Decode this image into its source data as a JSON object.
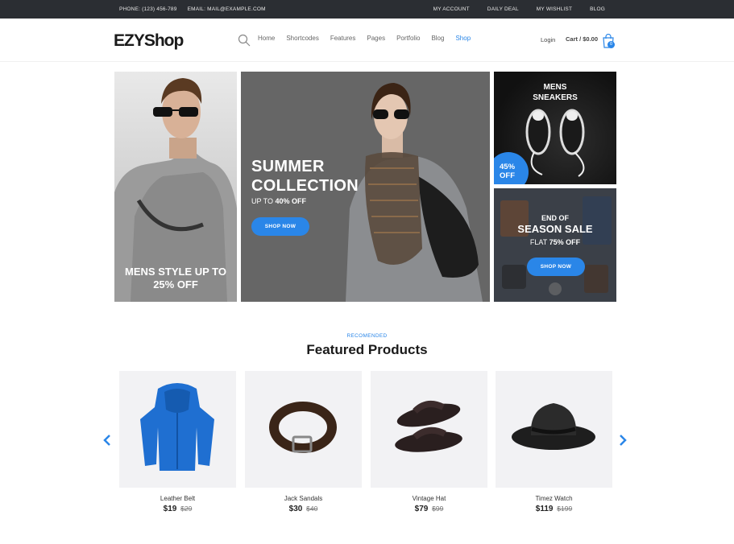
{
  "topbar": {
    "phone": "PHONE: (123) 456-789",
    "email": "EMAIL: MAIL@EXAMPLE.COM",
    "links": [
      "MY ACCOUNT",
      "DAILY DEAL",
      "MY WISHLIST",
      "BLOG"
    ]
  },
  "header": {
    "logo": "EZYShop",
    "nav": [
      "Home",
      "Shortcodes",
      "Features",
      "Pages",
      "Portfolio",
      "Blog",
      "Shop"
    ],
    "active_nav": "Shop",
    "login": "Login",
    "cart": "Cart / $0.00",
    "cart_count": "0"
  },
  "banners": {
    "mens": {
      "line1": "MENS STYLE UP TO",
      "line2": "25% OFF"
    },
    "summer": {
      "line1": "SUMMER",
      "line2": "COLLECTION",
      "sub_prefix": "UP TO ",
      "sub_value": "40% OFF",
      "button": "SHOP NOW"
    },
    "sneakers": {
      "line1": "MENS",
      "line2": "SNEAKERS",
      "badge_line1": "45%",
      "badge_line2": "OFF"
    },
    "season": {
      "line1": "END OF",
      "line2": "SEASON SALE",
      "sub_prefix": "FLAT ",
      "sub_value": "75% OFF",
      "button": "SHOP NOW"
    }
  },
  "featured": {
    "kicker": "RECOMENDED",
    "title": "Featured Products",
    "products": [
      {
        "name": "Leather Belt",
        "price": "$19",
        "old_price": "$29",
        "icon": "hoodie-icon"
      },
      {
        "name": "Jack Sandals",
        "price": "$30",
        "old_price": "$40",
        "icon": "belt-icon"
      },
      {
        "name": "Vintage Hat",
        "price": "$79",
        "old_price": "$99",
        "icon": "sandals-icon"
      },
      {
        "name": "Timez Watch",
        "price": "$119",
        "old_price": "$199",
        "icon": "hat-icon"
      }
    ]
  },
  "colors": {
    "accent": "#2a86e8",
    "topbar": "#2b2e33"
  }
}
